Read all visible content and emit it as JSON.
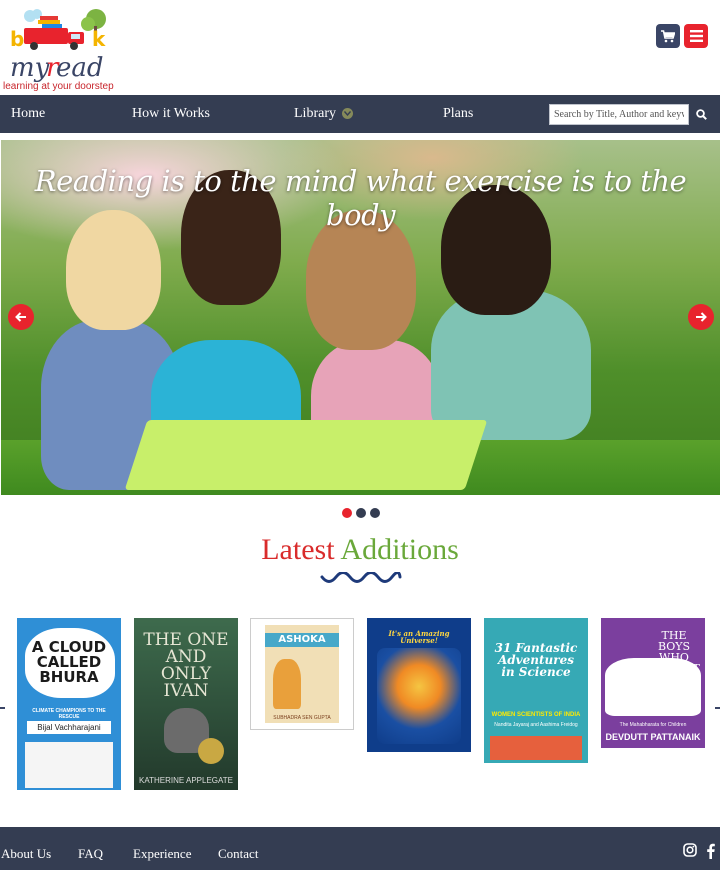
{
  "brand": {
    "logo_alt": "book myread",
    "tagline": "learning at your doorstep",
    "colors": {
      "navy": "#343d52",
      "red": "#e8232d",
      "green": "#6aa83a"
    }
  },
  "header_icons": {
    "cart": "cart-icon",
    "menu": "hamburger-menu-icon"
  },
  "nav": {
    "items": [
      {
        "label": "Home"
      },
      {
        "label": "How it Works"
      },
      {
        "label": "Library"
      },
      {
        "label": "Plans"
      }
    ],
    "search_placeholder": "Search by Title, Author and keywords",
    "search_icon": "search-icon"
  },
  "hero": {
    "quote": "Reading is to the mind what exercise is to the body",
    "slide_count": 3,
    "active_slide": 1
  },
  "latest": {
    "title_part1": "Latest",
    "title_part2": "Additions",
    "books": [
      {
        "title": "A CLOUD CALLED BHURA",
        "subtitle": "CLIMATE CHAMPIONS TO THE RESCUE",
        "author": "Bijal Vachharajani"
      },
      {
        "title": "THE ONE AND ONLY IVAN",
        "author": "KATHERINE APPLEGATE"
      },
      {
        "title": "ASHOKA",
        "author": "SUBHADRA SEN GUPTA"
      },
      {
        "title": "It's an Amazing Universe!"
      },
      {
        "title": "31 Fantastic Adventures in Science",
        "subtitle": "WOMEN SCIENTISTS OF INDIA",
        "author": "Nandita Jayaraj and Aashima Freidog"
      },
      {
        "title": "THE BOYS WHO FOUGHT",
        "subtitle": "The Mahabharata for Children",
        "author": "DEVDUTT PATTANAIK"
      }
    ]
  },
  "footer": {
    "links": [
      {
        "label": "About Us"
      },
      {
        "label": "FAQ"
      },
      {
        "label": "Experience"
      },
      {
        "label": "Contact"
      }
    ],
    "social": [
      "instagram-icon",
      "facebook-icon"
    ]
  }
}
